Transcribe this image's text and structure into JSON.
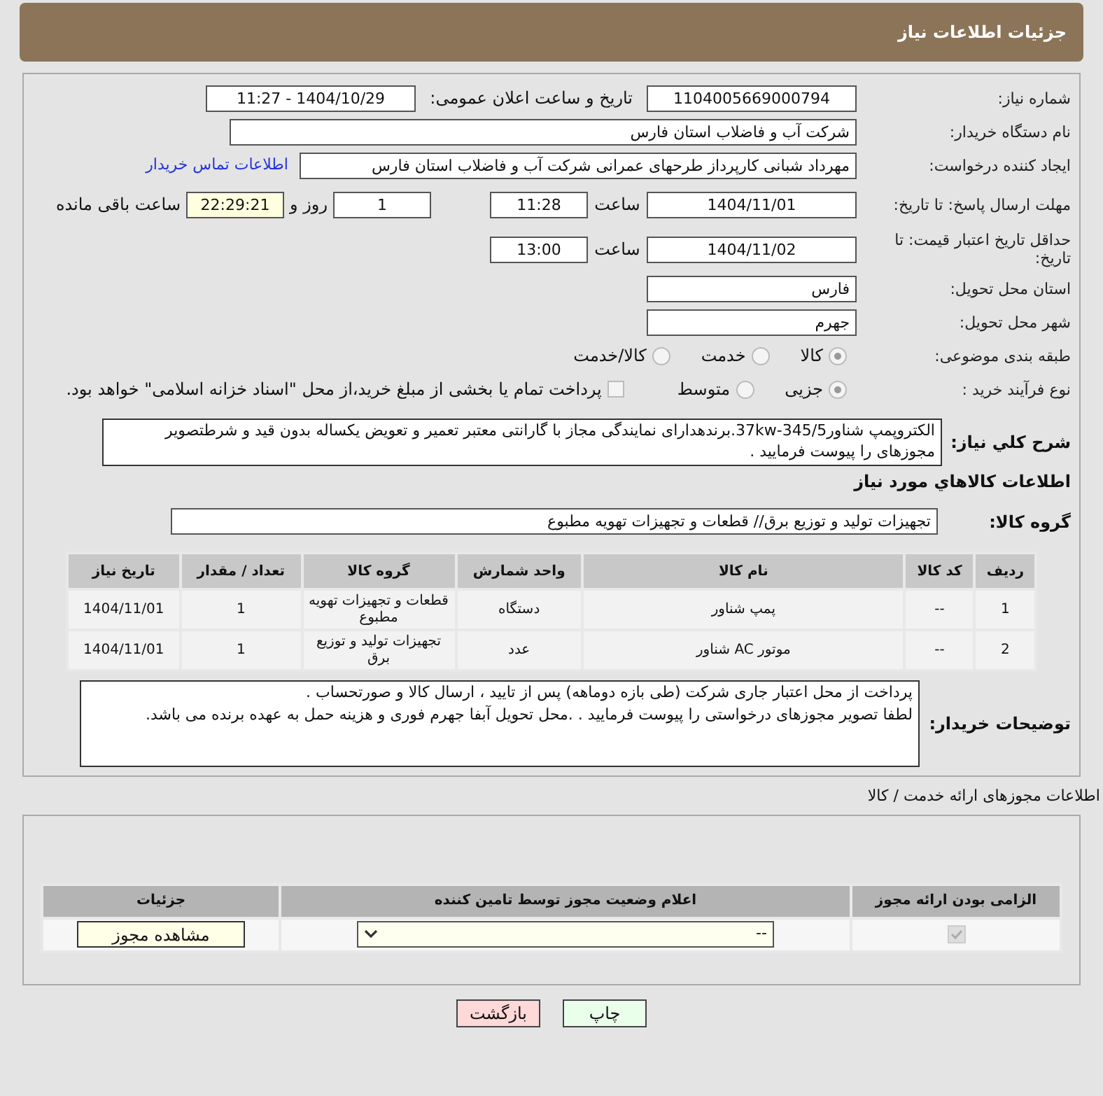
{
  "header": {
    "title": "جزئیات اطلاعات نیاز"
  },
  "need_number": {
    "label": "شماره نیاز:",
    "value": "1104005669000794"
  },
  "announce": {
    "label": "تاریخ و ساعت اعلان عمومی:",
    "value": "1404/10/29 - 11:27"
  },
  "buyer": {
    "label": "نام دستگاه خریدار:",
    "value": "شرکت آب و فاضلاب استان فارس"
  },
  "requester": {
    "label": "ایجاد کننده درخواست:",
    "value": "مهرداد شبانی کارپرداز طرحهای عمرانی  شرکت آب و فاضلاب استان فارس",
    "link": "اطلاعات تماس خریدار"
  },
  "deadline": {
    "label": "مهلت ارسال پاسخ: تا تاریخ:",
    "date": "1404/11/01",
    "time_label": "ساعت",
    "time": "11:28",
    "days": "1",
    "days_label": "روز و",
    "remaining": "22:29:21",
    "remaining_label": "ساعت باقی مانده"
  },
  "validity": {
    "label": "حداقل تاریخ اعتبار قیمت: تا تاریخ:",
    "date": "1404/11/02",
    "time_label": "ساعت",
    "time": "13:00"
  },
  "province": {
    "label": "استان محل تحویل:",
    "value": "فارس"
  },
  "city": {
    "label": "شهر محل تحویل:",
    "value": "جهرم"
  },
  "category": {
    "label": "طبقه بندی موضوعی:",
    "options": [
      {
        "label": "کالا",
        "selected": true
      },
      {
        "label": "خدمت",
        "selected": false
      },
      {
        "label": "کالا/خدمت",
        "selected": false
      }
    ]
  },
  "process": {
    "label": "نوع فرآیند خرید :",
    "options": [
      {
        "label": "جزیی",
        "selected": true
      },
      {
        "label": "متوسط",
        "selected": false
      }
    ],
    "treasury": {
      "label": "پرداخت تمام یا بخشی از مبلغ خرید،از محل \"اسناد خزانه اسلامی\" خواهد بود.",
      "checked": false
    }
  },
  "description": {
    "label": "شرح کلي نياز:",
    "value": "الکتروپمپ شناور37kw-345/5.برندهدارای نمایندگی مجاز با گارانتی معتبر تعمیر و تعویض یکساله بدون قید و شرطتصویر مجوزهای را پیوست فرمایید ."
  },
  "goods_heading": "اطلاعات کالاهاي مورد نياز",
  "goods_group": {
    "label": "گروه کالا:",
    "value": "تجهیزات تولید و توزیع برق//  قطعات و تجهیزات تهویه مطبوع"
  },
  "items_table": {
    "columns": [
      "ردیف",
      "کد کالا",
      "نام کالا",
      "واحد شمارش",
      "گروه کالا",
      "تعداد / مقدار",
      "تاریخ نیاز"
    ],
    "rows": [
      [
        "1",
        "--",
        "پمپ شناور",
        "دستگاه",
        "قطعات و تجهیزات تهویه مطبوع",
        "1",
        "1404/11/01"
      ],
      [
        "2",
        "--",
        "موتور AC شناور",
        "عدد",
        "تجهیزات تولید و توزیع برق",
        "1",
        "1404/11/01"
      ]
    ]
  },
  "buyer_notes": {
    "label": "توضیحات خریدار:",
    "lines": [
      "پرداخت از محل اعتبار جاری شرکت (طی بازه  دوماهه)  پس از تایید ، ارسال کالا و صورتحساب .",
      "لطفا تصویر مجوزهای درخواستی را پیوست فرمایید .  .محل تحویل آبفا جهرم  فوری و هزینه حمل به عهده برنده می باشد."
    ]
  },
  "licenses": {
    "title": "اطلاعات مجوزهای ارائه خدمت / کالا",
    "columns": [
      "الزامی بودن ارائه مجوز",
      "اعلام وضعیت مجوز توسط تامین کننده",
      "جزئیات"
    ],
    "rows": [
      {
        "required": true,
        "status": "--",
        "action": "مشاهده مجوز"
      }
    ]
  },
  "buttons": [
    {
      "label": "چاپ",
      "kind": "print"
    },
    {
      "label": "بازگشت",
      "kind": "back"
    }
  ]
}
